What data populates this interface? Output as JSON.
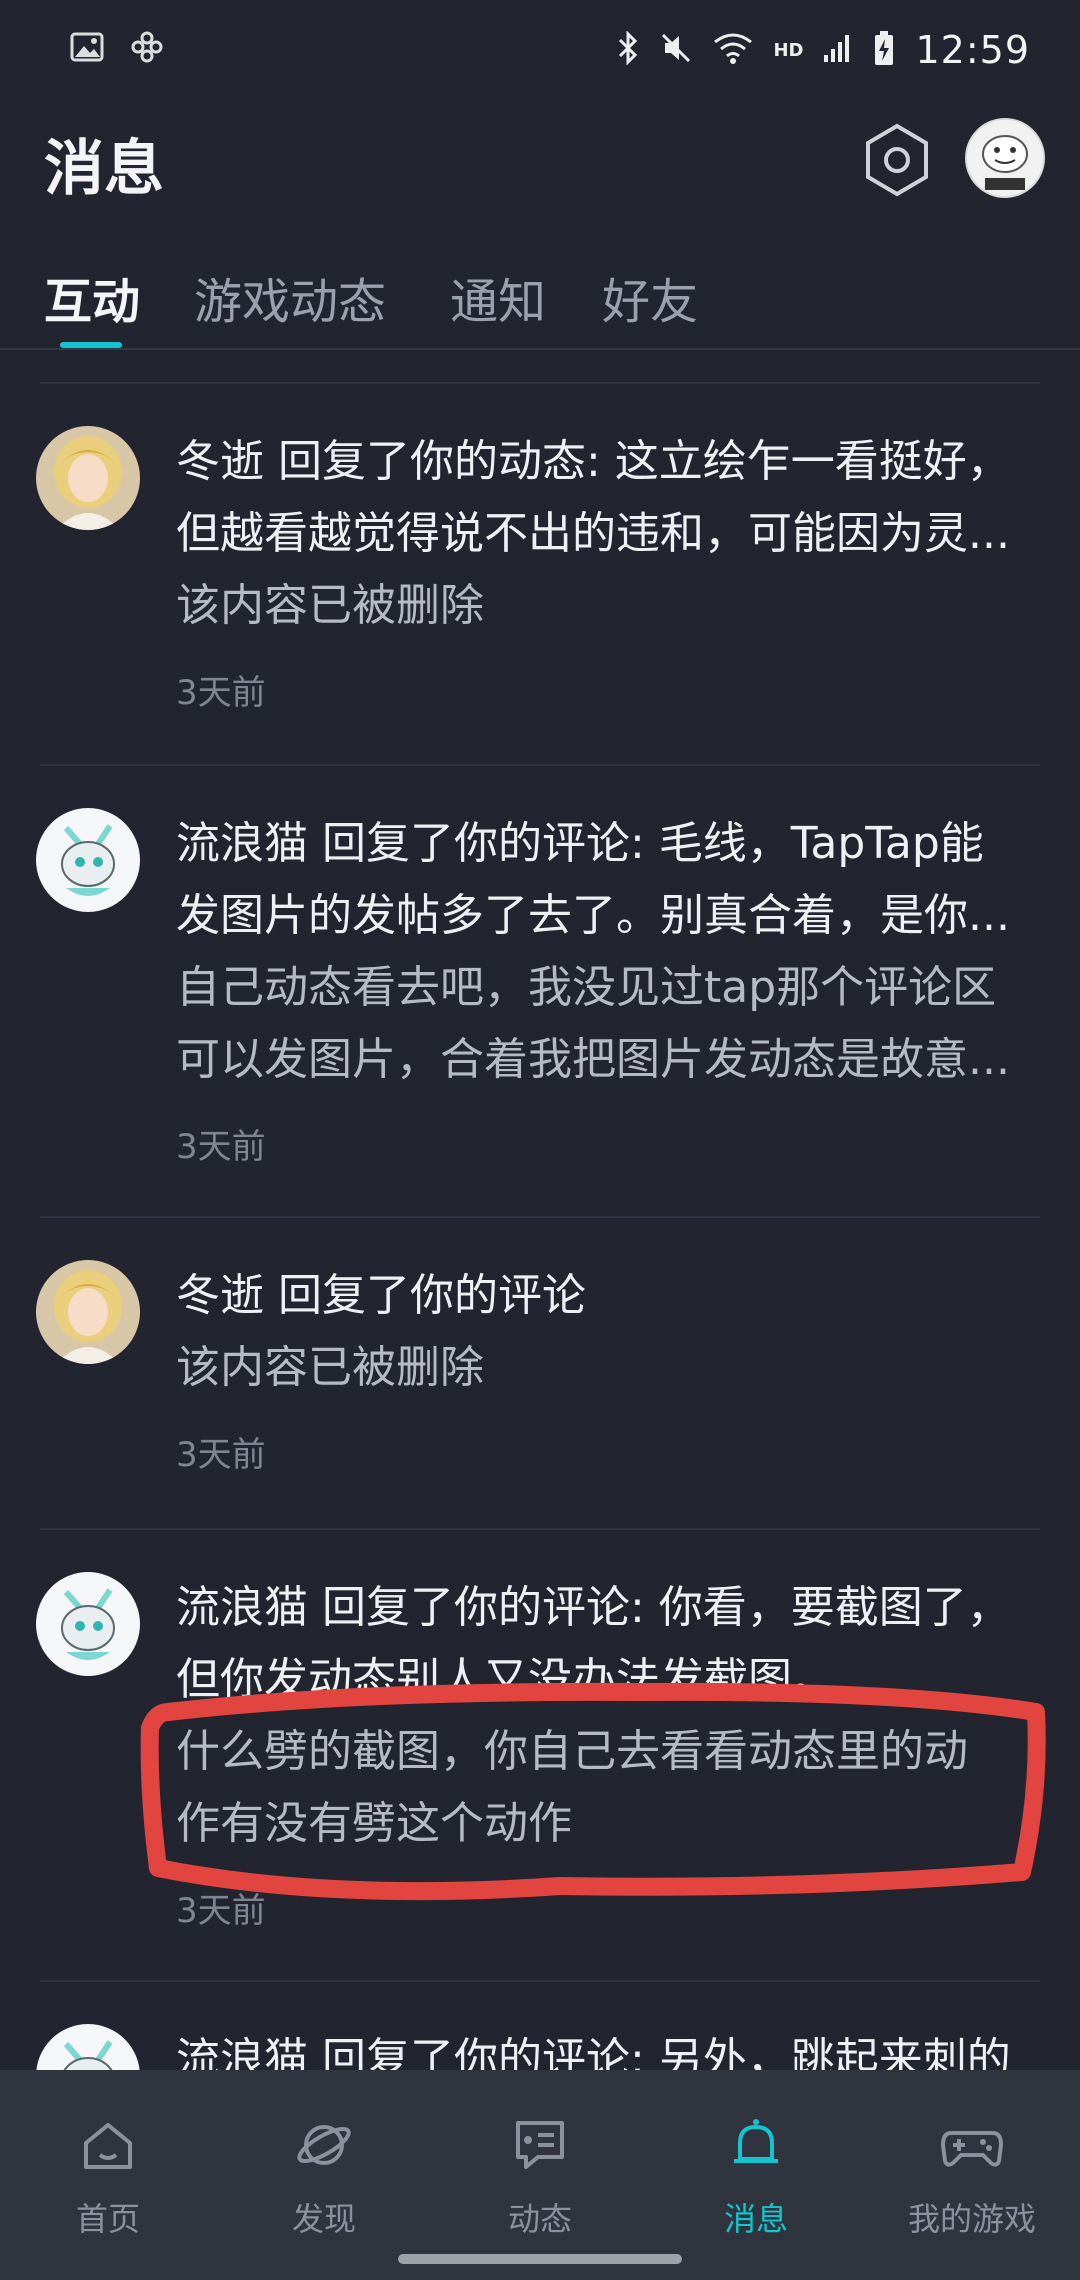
{
  "status_bar": {
    "time": "12:59",
    "network_label": "HD",
    "icons": [
      "image-icon",
      "pinwheel-icon",
      "bluetooth-icon",
      "mute-icon",
      "wifi-icon",
      "signal-icon",
      "battery-charging-icon"
    ]
  },
  "header": {
    "title": "消息",
    "settings_icon": "hexagon-settings-icon",
    "avatar_icon": "user-avatar"
  },
  "tabs": [
    {
      "label": "互动",
      "active": true
    },
    {
      "label": "游戏动态",
      "active": false
    },
    {
      "label": "通知",
      "active": false
    },
    {
      "label": "好友",
      "active": false
    }
  ],
  "messages": [
    {
      "avatar": "blonde-anime-avatar",
      "title_lines": [
        "冬逝 回复了你的动态: 这立绘乍一看挺好，",
        "但越看越觉得说不出的违和，可能因为灵..."
      ],
      "body_lines": [
        "该内容已被删除"
      ],
      "time": "3天前"
    },
    {
      "avatar": "robot-cat-avatar",
      "title_lines": [
        "流浪猫 回复了你的评论: 毛线，TapTap能",
        "发图片的发帖多了去了。别真合着，是你..."
      ],
      "body_lines": [
        "自己动态看去吧，我没见过tap那个评论区",
        "可以发图片，合着我把图片发动态是故意..."
      ],
      "time": "3天前"
    },
    {
      "avatar": "blonde-anime-avatar",
      "title_lines": [
        "冬逝 回复了你的评论"
      ],
      "body_lines": [
        "该内容已被删除"
      ],
      "time": "3天前"
    },
    {
      "avatar": "robot-cat-avatar",
      "title_lines": [
        "流浪猫 回复了你的评论: 你看，要截图了，",
        "但你发动态别人又没办法发截图。"
      ],
      "body_lines": [
        "什么劈的截图，你自己去看看动态里的动",
        "作有没有劈这个动作"
      ],
      "time": "3天前"
    },
    {
      "avatar": "robot-cat-avatar",
      "title_lines": [
        "流浪猫 回复了你的评论: 另外，跳起来刺的"
      ],
      "body_lines": [],
      "time": ""
    }
  ],
  "bottom_nav": [
    {
      "label": "首页",
      "icon": "home-icon",
      "active": false
    },
    {
      "label": "发现",
      "icon": "planet-icon",
      "active": false
    },
    {
      "label": "动态",
      "icon": "chat-card-icon",
      "active": false
    },
    {
      "label": "消息",
      "icon": "bell-icon",
      "active": true
    },
    {
      "label": "我的游戏",
      "icon": "gamepad-icon",
      "active": false
    }
  ],
  "colors": {
    "background": "#22252f",
    "accent": "#14c4cf",
    "annotation": "#e2453f"
  }
}
